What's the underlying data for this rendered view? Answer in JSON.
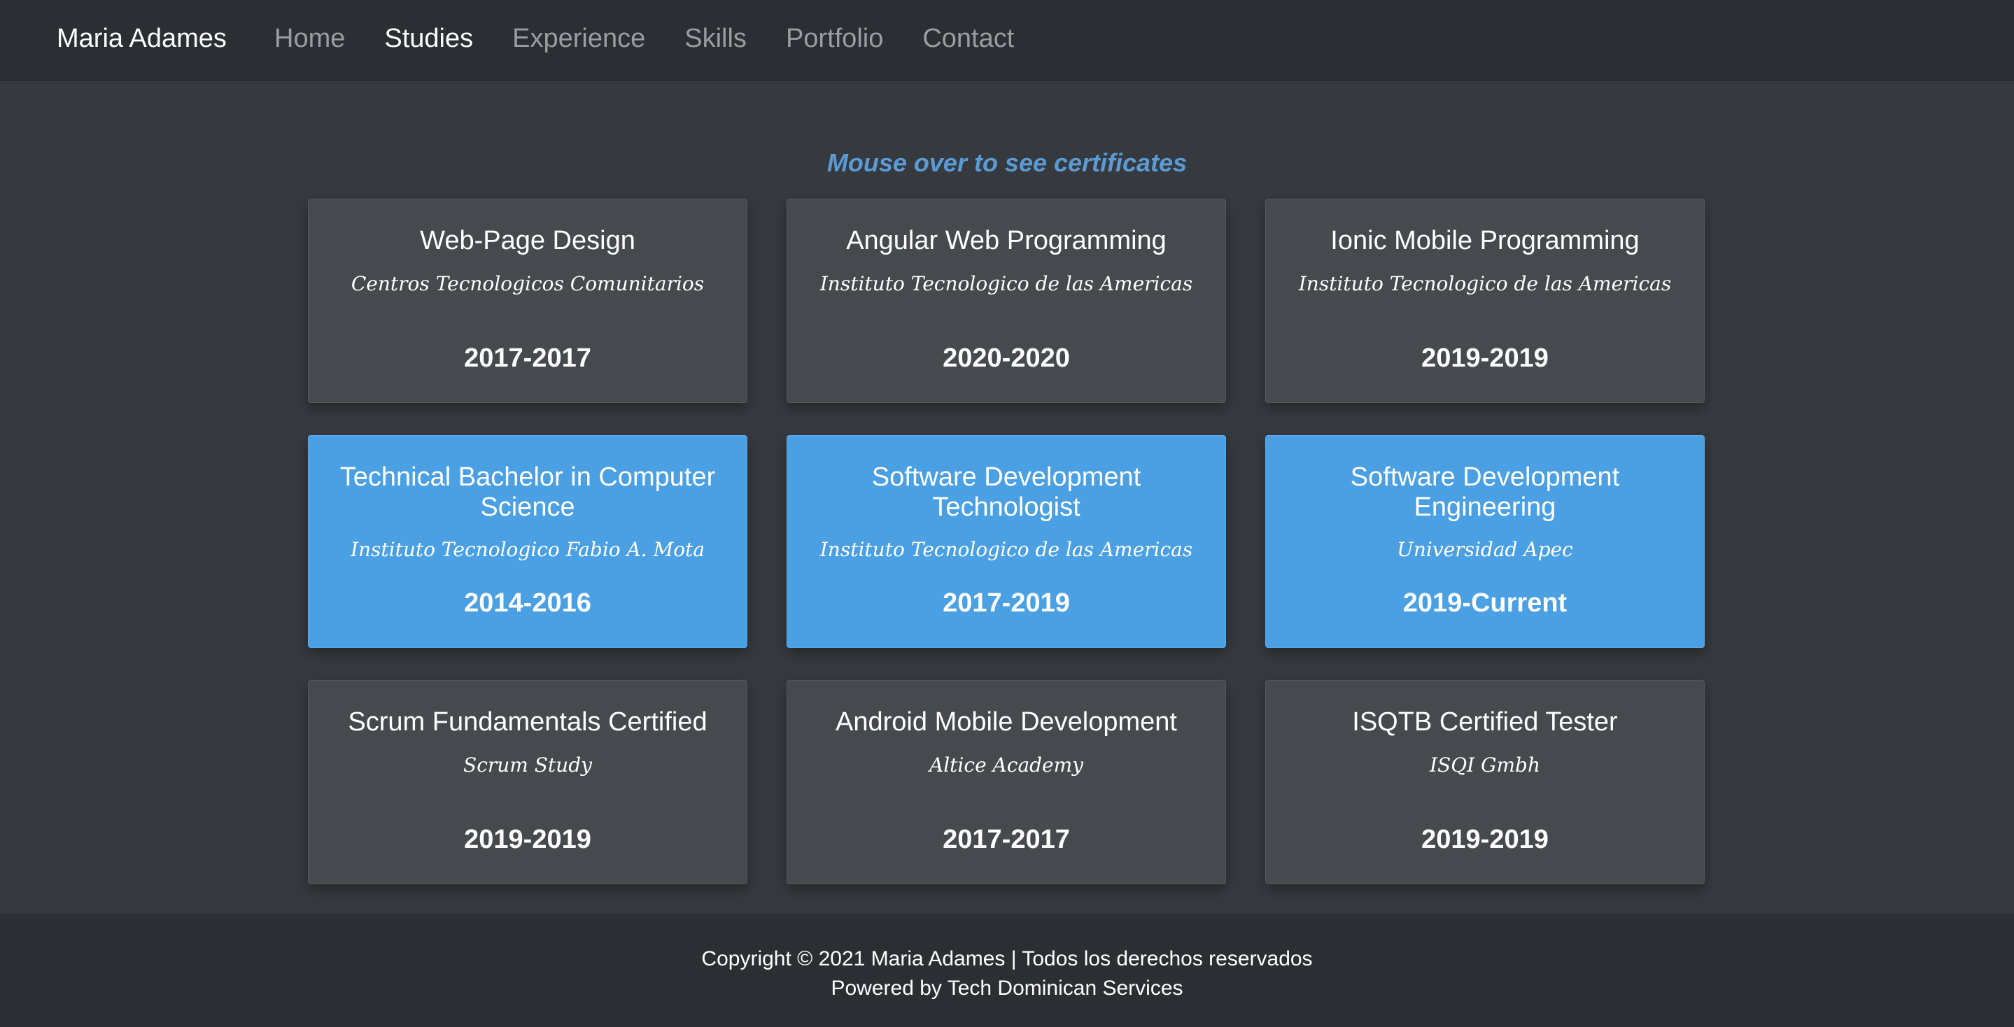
{
  "nav": {
    "brand": "Maria Adames",
    "links": [
      {
        "label": "Home",
        "active": false
      },
      {
        "label": "Studies",
        "active": true
      },
      {
        "label": "Experience",
        "active": false
      },
      {
        "label": "Skills",
        "active": false
      },
      {
        "label": "Portfolio",
        "active": false
      },
      {
        "label": "Contact",
        "active": false
      }
    ]
  },
  "hint": "Mouse over to see certificates",
  "studies": [
    {
      "title": "Web-Page Design",
      "institution": "Centros Tecnologicos Comunitarios",
      "years": "2017-2017",
      "highlighted": false
    },
    {
      "title": "Angular Web Programming",
      "institution": "Instituto Tecnologico de las Americas",
      "years": "2020-2020",
      "highlighted": false
    },
    {
      "title": "Ionic Mobile Programming",
      "institution": "Instituto Tecnologico de las Americas",
      "years": "2019-2019",
      "highlighted": false
    },
    {
      "title": "Technical Bachelor in Computer Science",
      "institution": "Instituto Tecnologico Fabio A. Mota",
      "years": "2014-2016",
      "highlighted": true
    },
    {
      "title": "Software Development Technologist",
      "institution": "Instituto Tecnologico de las Americas",
      "years": "2017-2019",
      "highlighted": true
    },
    {
      "title": "Software Development Engineering",
      "institution": "Universidad Apec",
      "years": "2019-Current",
      "highlighted": true
    },
    {
      "title": "Scrum Fundamentals Certified",
      "institution": "Scrum Study",
      "years": "2019-2019",
      "highlighted": false
    },
    {
      "title": "Android Mobile Development",
      "institution": "Altice Academy",
      "years": "2017-2017",
      "highlighted": false
    },
    {
      "title": "ISQTB Certified Tester",
      "institution": "ISQI Gmbh",
      "years": "2019-2019",
      "highlighted": false
    }
  ],
  "footer": {
    "copyright": "Copyright © 2021 Maria Adames | Todos los derechos reservados",
    "powered": "Powered by Tech Dominican Services"
  },
  "colors": {
    "background": "#363a3f",
    "navbar": "#2b2e33",
    "card": "#46494d",
    "card_highlight": "#4aa0e2",
    "hint": "#5b9bd5"
  }
}
